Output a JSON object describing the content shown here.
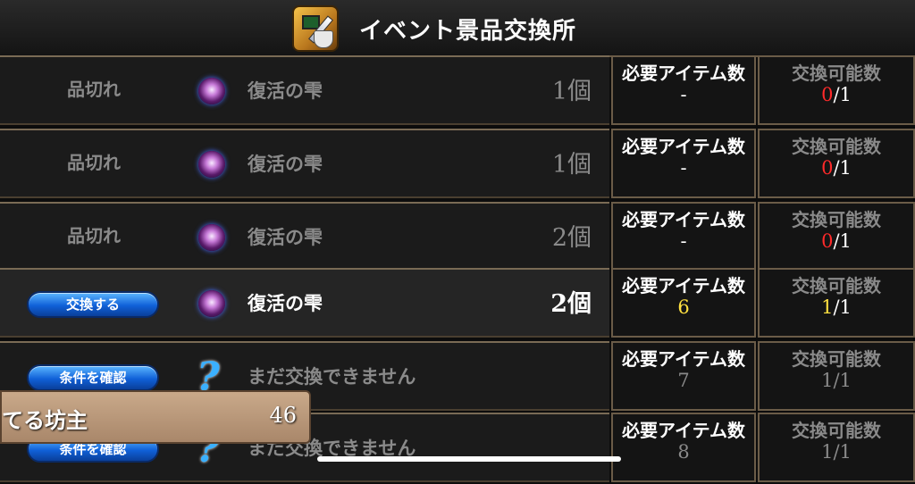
{
  "header": {
    "title": "イベント景品交換所"
  },
  "labels": {
    "required": "必要アイテム数",
    "exchangeable": "交換可能数"
  },
  "rows": [
    {
      "status": "品切れ",
      "item": "復活の雫",
      "qty": "1個",
      "required": "-",
      "count_current": "0",
      "count_total": "/1",
      "current_color": "red",
      "active": false,
      "button": null,
      "icon": "orb"
    },
    {
      "status": "品切れ",
      "item": "復活の雫",
      "qty": "1個",
      "required": "-",
      "count_current": "0",
      "count_total": "/1",
      "current_color": "red",
      "active": false,
      "button": null,
      "icon": "orb"
    },
    {
      "status": "品切れ",
      "item": "復活の雫",
      "qty": "2個",
      "required": "-",
      "count_current": "0",
      "count_total": "/1",
      "current_color": "red",
      "active": false,
      "button": null,
      "icon": "orb"
    },
    {
      "status": "",
      "item": "復活の雫",
      "qty": "2個",
      "required": "6",
      "count_current": "1",
      "count_total": "/1",
      "current_color": "yellow",
      "required_color": "yellow",
      "active": true,
      "button": "交換する",
      "icon": "orb"
    },
    {
      "status": "",
      "item": "まだ交換できません",
      "qty": "",
      "required": "7",
      "count_current": "1",
      "count_total": "/1",
      "current_color": "gray",
      "required_color": "gray",
      "active": false,
      "button": "条件を確認",
      "icon": "question"
    },
    {
      "status": "",
      "item": "まだ交換できません",
      "qty": "",
      "required": "8",
      "count_current": "1",
      "count_total": "/1",
      "current_color": "gray",
      "required_color": "gray",
      "active": false,
      "button": "条件を確認",
      "icon": "question"
    }
  ],
  "overlay": {
    "name": "てる坊主",
    "value": "46"
  }
}
